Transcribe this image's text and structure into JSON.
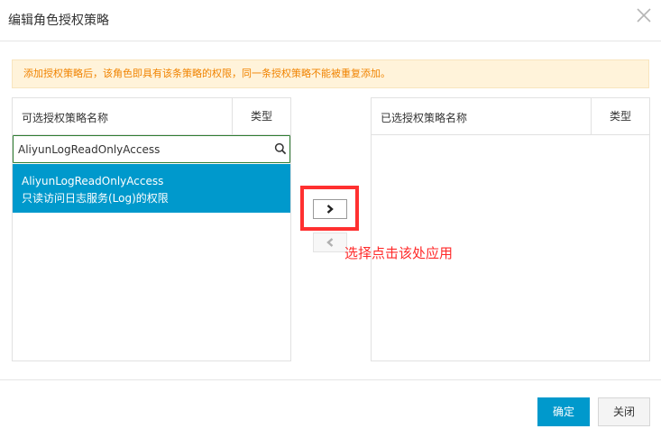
{
  "dialog": {
    "title": "编辑角色授权策略",
    "notice": "添加授权策略后，该角色即具有该条策略的权限，同一条授权策略不能被重复添加。"
  },
  "available": {
    "name_header": "可选授权策略名称",
    "type_header": "类型",
    "search_value": "AliyunLogReadOnlyAccess",
    "items": [
      {
        "name": "AliyunLogReadOnlyAccess",
        "description": "只读访问日志服务(Log)的权限"
      }
    ]
  },
  "selected": {
    "name_header": "已选授权策略名称",
    "type_header": "类型"
  },
  "annotation": {
    "hint": "选择点击该处应用",
    "color": "#ff2a2a"
  },
  "footer": {
    "ok_label": "确定",
    "close_label": "关闭"
  },
  "colors": {
    "accent": "#0099cc",
    "notice_text": "#f08300",
    "notice_bg": "#fff3da"
  }
}
